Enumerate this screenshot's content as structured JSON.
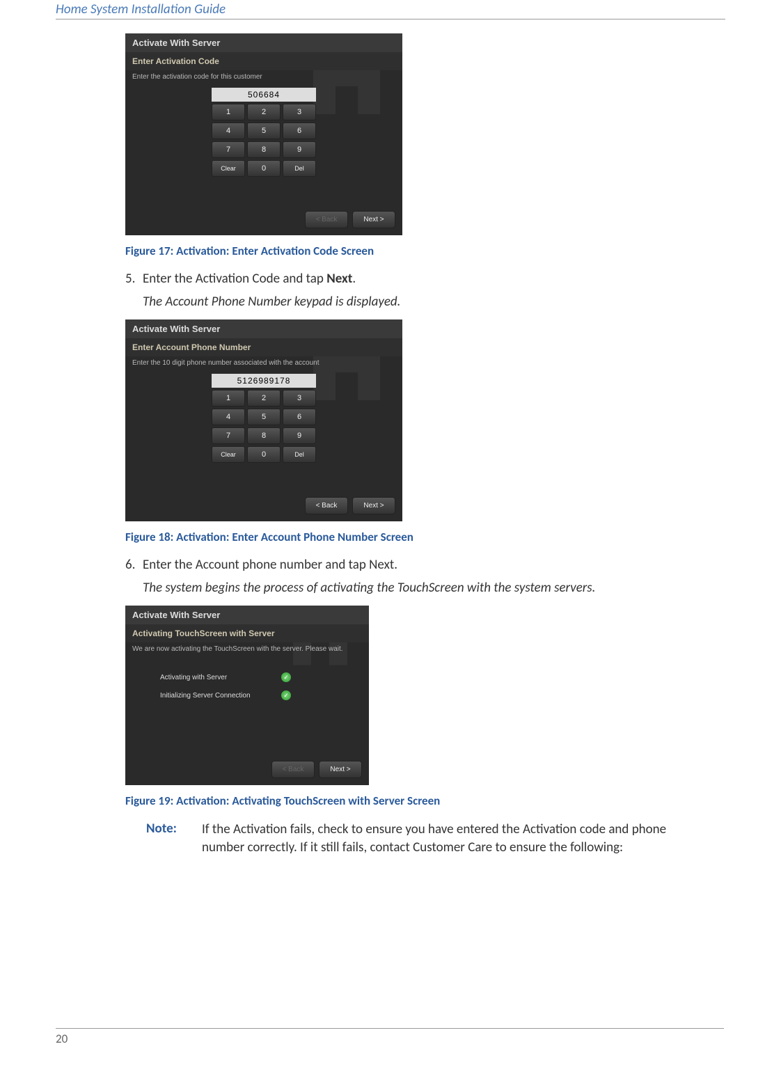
{
  "header": "Home System Installation Guide",
  "pageNumber": "20",
  "screen1": {
    "title": "Activate With Server",
    "subtitle": "Enter Activation Code",
    "instruction": "Enter the activation code for this customer",
    "display": "506684",
    "keys": {
      "k1": "1",
      "k2": "2",
      "k3": "3",
      "k4": "4",
      "k5": "5",
      "k6": "6",
      "k7": "7",
      "k8": "8",
      "k9": "9",
      "k0": "0",
      "clear": "Clear",
      "del": "Del"
    },
    "nav": {
      "back": "< Back",
      "next": "Next >"
    }
  },
  "figure17": "Figure 17:  Activation: Enter Activation Code Screen",
  "step5": {
    "number": "5.",
    "text_a": "Enter the Activation Code and tap ",
    "text_b": "Next",
    "text_c": "."
  },
  "step5_result": "The Account Phone Number keypad is displayed.",
  "screen2": {
    "title": "Activate With Server",
    "subtitle": "Enter Account Phone Number",
    "instruction": "Enter the 10 digit phone number associated with the account",
    "display": "5126989178",
    "keys": {
      "k1": "1",
      "k2": "2",
      "k3": "3",
      "k4": "4",
      "k5": "5",
      "k6": "6",
      "k7": "7",
      "k8": "8",
      "k9": "9",
      "k0": "0",
      "clear": "Clear",
      "del": "Del"
    },
    "nav": {
      "back": "< Back",
      "next": "Next >"
    }
  },
  "figure18": "Figure 18:  Activation: Enter Account Phone Number Screen",
  "step6": {
    "number": "6.",
    "text": "Enter the Account phone number and tap Next."
  },
  "step6_result": "The system begins the process of activating the TouchScreen with the system servers.",
  "screen3": {
    "title": "Activate With Server",
    "subtitle": "Activating TouchScreen with Server",
    "instruction": "We are now activating the TouchScreen with the server. Please wait.",
    "status1": "Activating with Server",
    "status2": "Initializing Server Connection",
    "nav": {
      "back": "< Back",
      "next": "Next >"
    }
  },
  "figure19": "Figure 19:  Activation: Activating TouchScreen with Server Screen",
  "note": {
    "label": "Note:",
    "text": "If the Activation fails, check to ensure you have entered the Activation code and phone number correctly. If it still fails, contact Customer Care to ensure the following:"
  }
}
